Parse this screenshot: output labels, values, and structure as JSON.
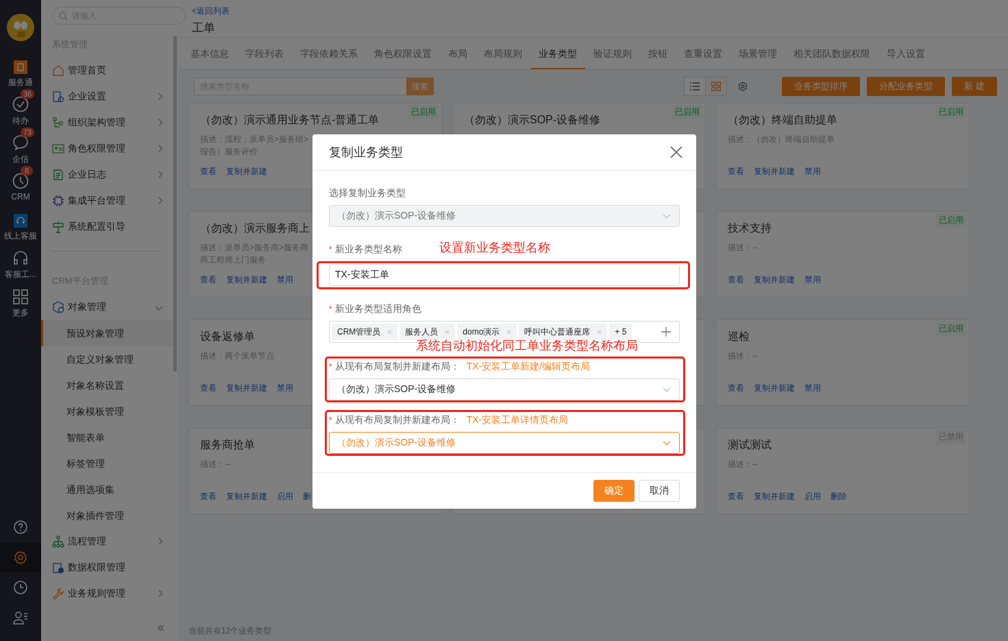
{
  "rail": {
    "items": [
      {
        "label": "服务通"
      },
      {
        "label": "待办",
        "badge": "36"
      },
      {
        "label": "企信",
        "badge": "73"
      },
      {
        "label": "CRM",
        "badge": "8"
      },
      {
        "label": "线上客服"
      },
      {
        "label": "客服工..."
      },
      {
        "label": "更多"
      }
    ],
    "bottom": [
      {
        "selected": false
      },
      {
        "selected": true
      },
      {
        "selected": false
      },
      {
        "selected": false
      }
    ]
  },
  "sidebar": {
    "search": {
      "placeholder": "请输入"
    },
    "sections": [
      {
        "title": "系统管理",
        "items": [
          {
            "label": "管理首页"
          },
          {
            "label": "企业设置",
            "expanded": false
          },
          {
            "label": "组织架构管理",
            "expanded": false
          },
          {
            "label": "角色权限管理",
            "expanded": false
          },
          {
            "label": "企业日志",
            "expanded": false
          },
          {
            "label": "集成平台管理",
            "expanded": false
          },
          {
            "label": "系统配置引导"
          }
        ]
      },
      {
        "title": "CRM平台管理",
        "items": [
          {
            "label": "对象管理",
            "expanded": true,
            "children": [
              {
                "label": "预设对象管理",
                "selected": true
              },
              {
                "label": "自定义对象管理",
                "selected": false
              },
              {
                "label": "对象名称设置",
                "selected": false
              },
              {
                "label": "对象模板管理",
                "selected": false
              },
              {
                "label": "智能表单",
                "selected": false
              },
              {
                "label": "标签管理",
                "selected": false
              },
              {
                "label": "通用选项集",
                "selected": false
              },
              {
                "label": "对象插件管理",
                "selected": false
              }
            ]
          },
          {
            "label": "流程管理",
            "expanded": false
          },
          {
            "label": "数据权限管理"
          },
          {
            "label": "业务规则管理",
            "expanded": false
          }
        ]
      }
    ]
  },
  "header": {
    "back_link": "<返回列表",
    "title": "工单"
  },
  "tabs": [
    {
      "label": "基本信息",
      "selected": false
    },
    {
      "label": "字段列表",
      "selected": false
    },
    {
      "label": "字段依赖关系",
      "selected": false
    },
    {
      "label": "角色权限设置",
      "selected": false
    },
    {
      "label": "布局",
      "selected": false
    },
    {
      "label": "布局规则",
      "selected": false
    },
    {
      "label": "业务类型",
      "selected": true
    },
    {
      "label": "验证规则",
      "selected": false
    },
    {
      "label": "按钮",
      "selected": false
    },
    {
      "label": "查重设置",
      "selected": false
    },
    {
      "label": "场景管理",
      "selected": false
    },
    {
      "label": "相关团队数据权限",
      "selected": false
    },
    {
      "label": "导入设置",
      "selected": false
    }
  ],
  "toolbar": {
    "search": {
      "placeholder": "搜索类型名称"
    },
    "search_button": "搜索",
    "views": [
      {
        "selected": false
      },
      {
        "selected": true
      }
    ],
    "buttons": [
      "业务类型排序",
      "分配业务类型",
      "新 建"
    ]
  },
  "cards": [
    {
      "kind": "card",
      "title": "（勿改）演示通用业务节点-普通工单",
      "status": {
        "label": "已启用",
        "enabled": true
      },
      "description": [
        "描述：流程：派单员>服务组>",
        "报告）服务评价"
      ],
      "actions": [
        "查看",
        "复制并新建"
      ]
    },
    {
      "kind": "card",
      "title": "（勿改）演示SOP-设备维修",
      "status": {
        "label": "已启用",
        "enabled": true
      }
    },
    {
      "kind": "card",
      "title": "（勿改）终端自助提单",
      "status": {
        "label": "已启用",
        "enabled": true
      },
      "description": [
        "描述：（勿改）终端自助提单"
      ],
      "actions": [
        "查看",
        "复制并新建",
        "禁用"
      ]
    },
    {
      "kind": "card",
      "title": "（勿改）演示服务商上",
      "description": [
        "描述：派单员>服务商>服务商",
        "商工程师上门服务"
      ],
      "actions": [
        "查看",
        "复制并新建",
        "禁用"
      ]
    },
    {
      "kind": "covered"
    },
    {
      "kind": "card",
      "title": "技术支持",
      "status": {
        "label": "已启用",
        "enabled": true
      },
      "description": [
        "描述：--"
      ],
      "actions": [
        "查看",
        "复制并新建",
        "禁用"
      ]
    },
    {
      "kind": "card",
      "title": "设备返修单",
      "description": [
        "描述：两个派单节点"
      ],
      "actions": [
        "查看",
        "复制并新建",
        "禁用"
      ]
    },
    {
      "kind": "covered"
    },
    {
      "kind": "card",
      "title": "巡检",
      "status": {
        "label": "已启用",
        "enabled": true
      },
      "description": [
        "描述：--"
      ],
      "actions": [
        "查看",
        "复制并新建",
        "禁用"
      ]
    },
    {
      "kind": "card",
      "title": "服务商抢单",
      "description": [
        "描述：--"
      ],
      "actions": [
        "查看",
        "复制并新建",
        "启用",
        "删"
      ]
    },
    {
      "kind": "covered"
    },
    {
      "kind": "card",
      "title": "测试测试",
      "status": {
        "label": "已禁用",
        "enabled": false
      },
      "description": [
        "描述：--"
      ],
      "actions": [
        "查看",
        "复制并新建",
        "启用",
        "删除"
      ]
    }
  ],
  "footer": "当前共有12个业务类型",
  "dialog": {
    "title": "复制业务类型",
    "fields": [
      {
        "kind": "select",
        "label": "选择复制业务类型",
        "value": "（勿改）演示SOP-设备维修",
        "disabled": true
      },
      {
        "kind": "input",
        "marker": "*",
        "label": "新业务类型名称",
        "value": "TX-安装工单",
        "note": "设置新业务类型名称",
        "highlighted": true
      },
      {
        "kind": "tags",
        "marker": "*",
        "label": "新业务类型适用角色",
        "tags": [
          "CRM管理员",
          "服务人员",
          "domo演示",
          "呼叫中心普通座席"
        ],
        "more": "+ 5"
      },
      {
        "kind": "select",
        "marker": "*",
        "label": "从现有布局复制并新建布局：",
        "hint": "TX-安装工单新建/编辑页布局",
        "value": "（勿改）演示SOP-设备维修",
        "disabled": false,
        "focused": false,
        "note_above": "系统自动初始化同工单业务类型名称布局",
        "highlighted": true
      },
      {
        "kind": "select",
        "marker": "*",
        "label": "从现有布局复制并新建布局：",
        "hint": "TX-安装工单详情页布局",
        "value": "（勿改）演示SOP-设备维修",
        "disabled": false,
        "focused": true,
        "highlighted": true
      }
    ],
    "buttons": [
      {
        "label": "确定",
        "primary": true
      },
      {
        "label": "取消",
        "primary": false
      }
    ]
  }
}
